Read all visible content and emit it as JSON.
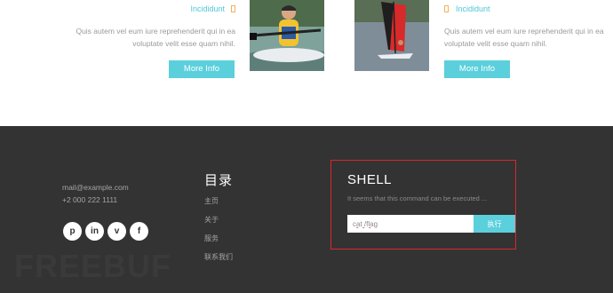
{
  "features": {
    "left": {
      "category": "Incididunt",
      "description_line1": "Quis autem vel eum iure reprehenderit qui in ea",
      "description_line2": "voluptate velit esse quam nihil.",
      "button": "More Info"
    },
    "right": {
      "category": "Incididunt",
      "description_line1": "Quis autem vel eum iure reprehenderit qui in ea",
      "description_line2": "voluptate velit esse quam nihil.",
      "button": "More Info"
    }
  },
  "footer": {
    "email": "mail@example.com",
    "phone": "+2 000 222 1111",
    "socials": [
      {
        "icon": "pinterest-icon",
        "glyph": "p"
      },
      {
        "icon": "linkedin-icon",
        "glyph": "in"
      },
      {
        "icon": "vimeo-icon",
        "glyph": "v"
      },
      {
        "icon": "facebook-icon",
        "glyph": "f"
      }
    ],
    "menu": {
      "title": "目录",
      "items": [
        "主页",
        "关于",
        "服务",
        "联系我们"
      ]
    },
    "shell": {
      "title": "SHELL",
      "description": "It seems that this command can be executed ...",
      "input_value": "cat /flag",
      "button": "执行"
    }
  },
  "watermark": "FREEBUF",
  "colors": {
    "accent": "#5bd0dc",
    "footer_bg": "#333333",
    "highlight_border": "#d9262c"
  }
}
